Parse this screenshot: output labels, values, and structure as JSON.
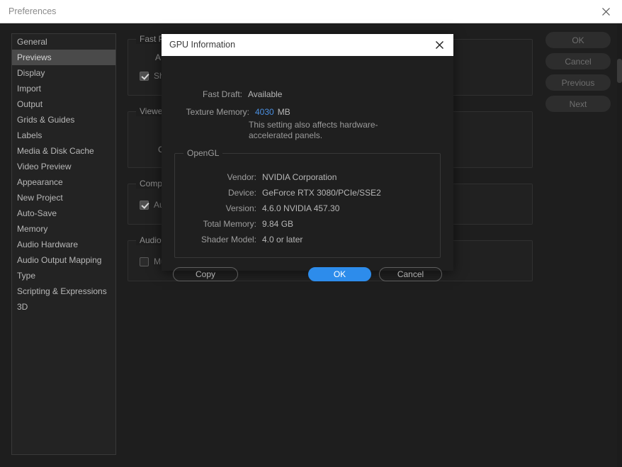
{
  "window": {
    "title": "Preferences",
    "close_icon": "close-icon"
  },
  "sidebar": {
    "items": [
      {
        "label": "General",
        "selected": false
      },
      {
        "label": "Previews",
        "selected": true
      },
      {
        "label": "Display",
        "selected": false
      },
      {
        "label": "Import",
        "selected": false
      },
      {
        "label": "Output",
        "selected": false
      },
      {
        "label": "Grids & Guides",
        "selected": false
      },
      {
        "label": "Labels",
        "selected": false
      },
      {
        "label": "Media & Disk Cache",
        "selected": false
      },
      {
        "label": "Video Preview",
        "selected": false
      },
      {
        "label": "Appearance",
        "selected": false
      },
      {
        "label": "New Project",
        "selected": false
      },
      {
        "label": "Auto-Save",
        "selected": false
      },
      {
        "label": "Memory",
        "selected": false
      },
      {
        "label": "Audio Hardware",
        "selected": false
      },
      {
        "label": "Audio Output Mapping",
        "selected": false
      },
      {
        "label": "Type",
        "selected": false
      },
      {
        "label": "Scripting & Expressions",
        "selected": false
      },
      {
        "label": "3D",
        "selected": false
      }
    ]
  },
  "settings": {
    "groups": [
      {
        "legend": "Fast Pre",
        "sub": "A",
        "checkbox": {
          "label": "Sho",
          "checked": true
        }
      },
      {
        "legend": "Viewer C",
        "sub": "C",
        "checkbox": null
      },
      {
        "legend": "Composi",
        "sub": "",
        "checkbox": {
          "label": "Aut",
          "checked": true
        }
      },
      {
        "legend": "Audio",
        "sub": "",
        "checkbox": {
          "label": "Mut",
          "checked": false
        }
      }
    ]
  },
  "right_buttons": [
    {
      "label": "OK",
      "enabled": false
    },
    {
      "label": "Cancel",
      "enabled": false
    },
    {
      "label": "Previous",
      "enabled": false
    },
    {
      "label": "Next",
      "enabled": false
    }
  ],
  "gpu_dialog": {
    "title": "GPU Information",
    "close_icon": "close-icon",
    "fast_draft": {
      "label": "Fast Draft:",
      "value": "Available"
    },
    "texture_memory": {
      "label": "Texture Memory:",
      "value": "4030",
      "unit": "MB",
      "value_color": "#4a8fe0"
    },
    "note": "This setting also affects hardware-accelerated panels.",
    "opengl": {
      "legend": "OpenGL",
      "rows": [
        {
          "label": "Vendor:",
          "value": "NVIDIA Corporation"
        },
        {
          "label": "Device:",
          "value": "GeForce RTX 3080/PCIe/SSE2"
        },
        {
          "label": "Version:",
          "value": "4.6.0 NVIDIA 457.30"
        },
        {
          "label": "Total Memory:",
          "value": "9.84 GB"
        },
        {
          "label": "Shader Model:",
          "value": "4.0 or later"
        }
      ]
    },
    "buttons": {
      "copy": "Copy",
      "ok": "OK",
      "cancel": "Cancel"
    }
  }
}
